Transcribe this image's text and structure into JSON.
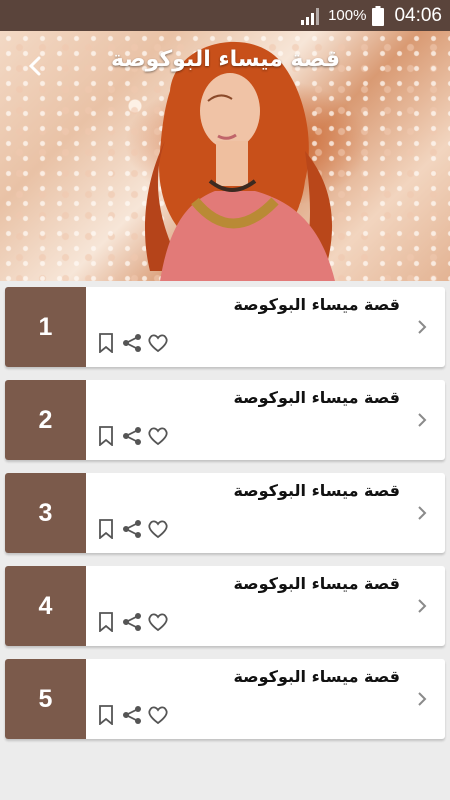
{
  "status_bar": {
    "battery_percent": "100%",
    "time": "04:06",
    "icons": [
      "signal-icon",
      "battery-icon"
    ]
  },
  "header": {
    "title": "قصة ميساء البوكوصة",
    "back_icon": "chevron-left-icon"
  },
  "colors": {
    "status_bar_bg": "#5a443b",
    "number_block_bg": "#7b5a4b",
    "page_bg": "#ececec"
  },
  "items": [
    {
      "number": "1",
      "title": "قصة ميساء البوكوصة"
    },
    {
      "number": "2",
      "title": "قصة ميساء البوكوصة"
    },
    {
      "number": "3",
      "title": "قصة ميساء البوكوصة"
    },
    {
      "number": "4",
      "title": "قصة ميساء البوكوصة"
    },
    {
      "number": "5",
      "title": "قصة ميساء البوكوصة"
    }
  ],
  "item_action_icons": [
    "bookmark-icon",
    "share-icon",
    "heart-icon"
  ]
}
